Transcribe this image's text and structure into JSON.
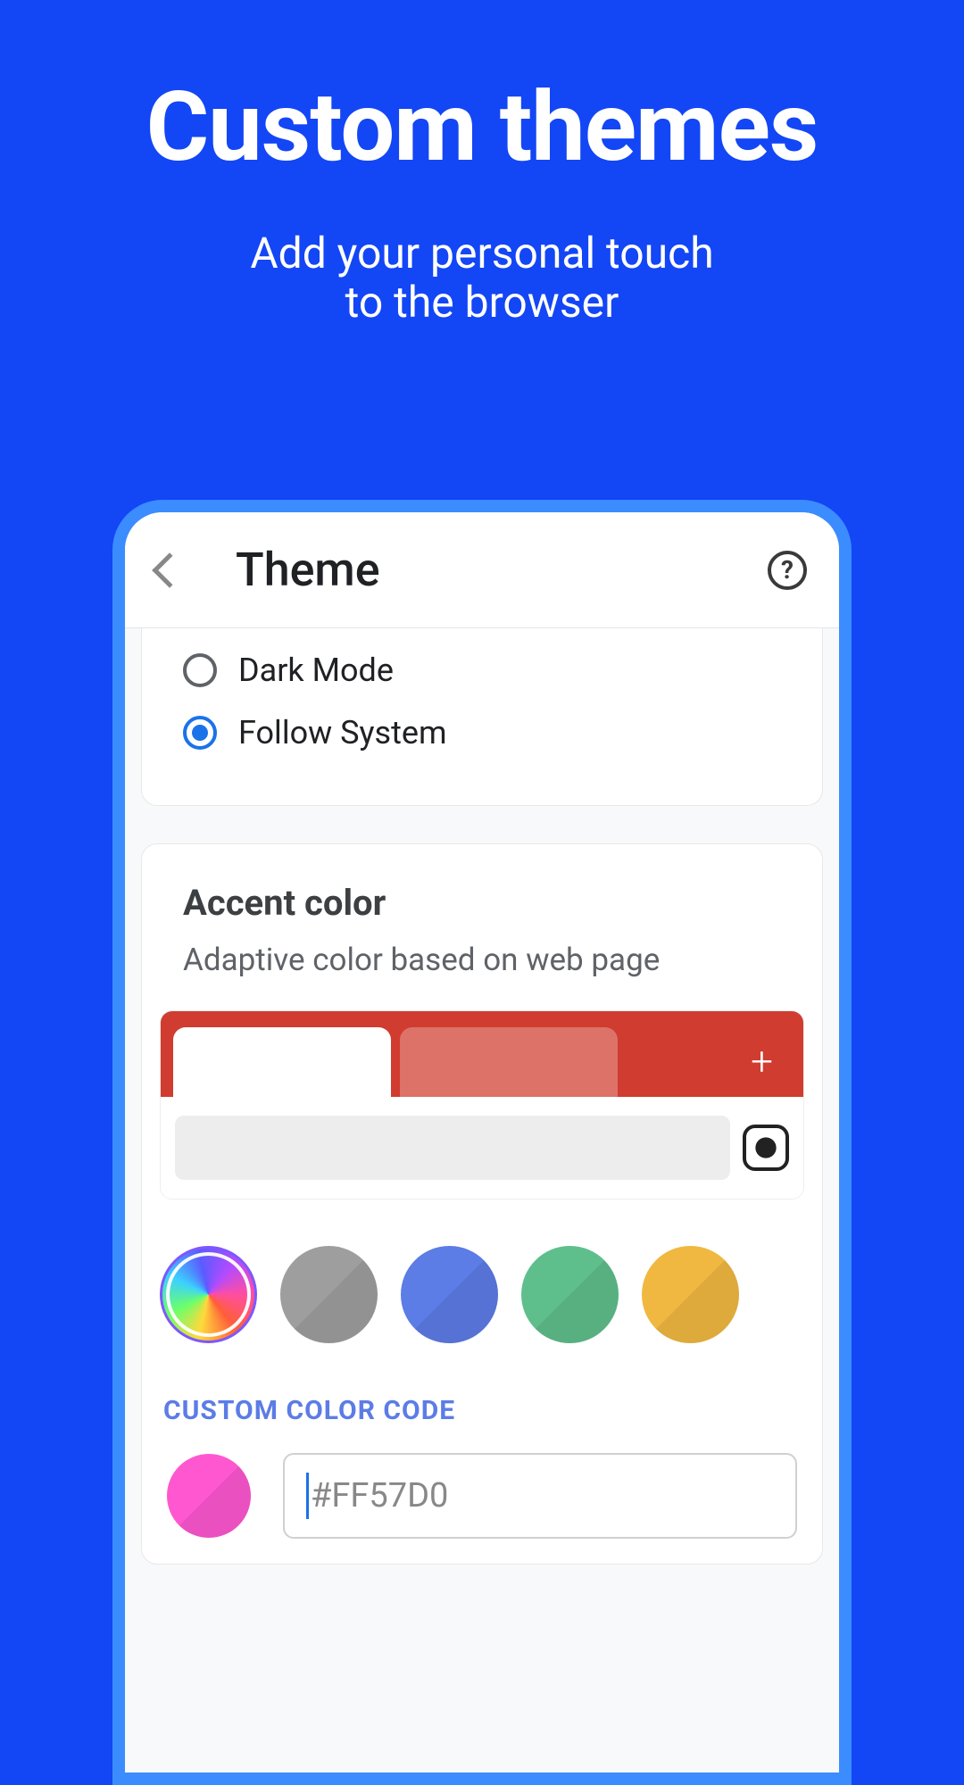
{
  "promo": {
    "title": "Custom themes",
    "subtitle_line1": "Add your personal touch",
    "subtitle_line2": "to the browser"
  },
  "header": {
    "title": "Theme",
    "help": "?"
  },
  "mode": {
    "options": [
      {
        "label": "Dark Mode",
        "selected": false
      },
      {
        "label": "Follow System",
        "selected": true
      }
    ]
  },
  "accent": {
    "title": "Accent color",
    "subtitle": "Adaptive color based on web page",
    "swatches": [
      {
        "name": "rainbow",
        "color": "rainbow"
      },
      {
        "name": "gray",
        "color": "#9E9E9E"
      },
      {
        "name": "blue",
        "color": "#5C7CE6"
      },
      {
        "name": "green",
        "color": "#5FBF8C"
      },
      {
        "name": "yellow",
        "color": "#F0B840"
      }
    ],
    "preview_plus": "+"
  },
  "custom": {
    "label": "CUSTOM COLOR CODE",
    "value": "#FF57D0",
    "swatch_color": "#FF57D0"
  }
}
